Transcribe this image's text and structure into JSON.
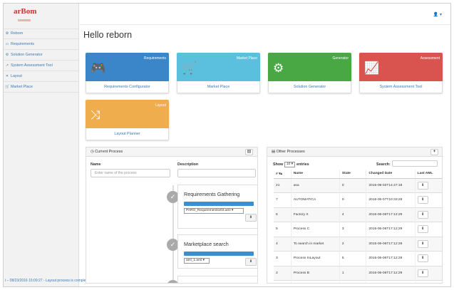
{
  "sidebar": {
    "logo": "arBom",
    "items": [
      {
        "icon": "⚙",
        "label": "Reborn"
      },
      {
        "icon": "▭",
        "label": "Requirements"
      },
      {
        "icon": "⚙",
        "label": "Solution Generator"
      },
      {
        "icon": "↗",
        "label": "System Assessment Tool"
      },
      {
        "icon": "✕",
        "label": "Layout"
      },
      {
        "icon": "🛒",
        "label": "Market Place"
      }
    ],
    "status": "i – 08/23/2016 15:09:27 - Layout process is complete."
  },
  "header": {
    "user": "👤 ▾"
  },
  "greeting": "Hello reborn",
  "tiles": [
    {
      "title": "Requirements",
      "icon": "🎮",
      "footer": "Requirements Configurator",
      "color": "#3a86c8"
    },
    {
      "title": "Market Place",
      "icon": "🛒",
      "footer": "Market Place",
      "color": "#5bc0de"
    },
    {
      "title": "Generator",
      "icon": "⚙",
      "footer": "Solution Generator",
      "color": "#49a844"
    },
    {
      "title": "Assessment",
      "icon": "📈",
      "footer": "System Assessment Tool",
      "color": "#d9534f"
    },
    {
      "title": "Layout",
      "icon": "⤨",
      "footer": "Layout Planner",
      "color": "#f0ad4e"
    }
  ],
  "current_process": {
    "title": "Current Process",
    "name_label": "Name",
    "name_placeholder": "Enter name of the process",
    "desc_label": "Description",
    "steps": [
      {
        "title": "Requirements Gathering",
        "select": "PARO_Requirementsv03.aml ▾"
      },
      {
        "title": "Marketplace search",
        "select": "aml_1.aml ▾"
      }
    ]
  },
  "other_processes": {
    "title": "Other Processes",
    "show": "Show",
    "show_value": "10 ▾",
    "entries": "entries",
    "search_label": "Search:",
    "columns": [
      "# ▾▴",
      "Name",
      "State",
      "Changed Date",
      "Last AML"
    ],
    "rows": [
      [
        "21",
        "asa",
        "0",
        "2016-08-02T14:47:18"
      ],
      [
        "7",
        "AUTOMATICA",
        "0",
        "2016-06-07T10:33:29"
      ],
      [
        "6",
        "Factory X",
        "4",
        "2016-06-06T17:12:29"
      ],
      [
        "5",
        "Process C",
        "3",
        "2016-06-06T17:12:29"
      ],
      [
        "4",
        "To search in market",
        "2",
        "2016-06-06T17:12:29"
      ],
      [
        "3",
        "Process InLayout",
        "5",
        "2016-06-06T17:12:29"
      ],
      [
        "2",
        "Process B",
        "1",
        "2016-06-06T17:12:29"
      ],
      [
        "1",
        "Fact Process A",
        "6",
        "2016-06-06T17:12:29"
      ]
    ]
  }
}
